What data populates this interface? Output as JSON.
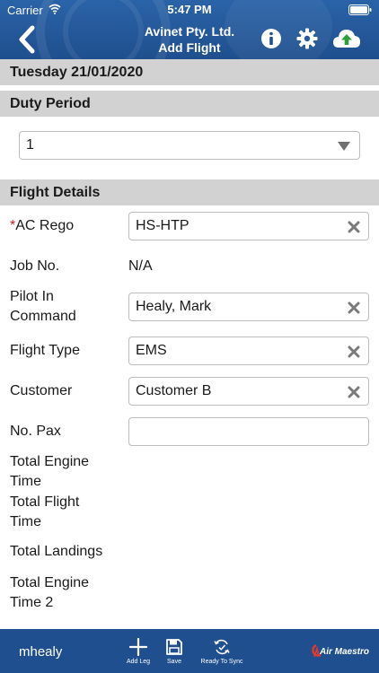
{
  "status_bar": {
    "carrier": "Carrier",
    "time": "5:47 PM"
  },
  "header": {
    "company": "Avinet Pty. Ltd.",
    "title": "Add Flight"
  },
  "date_bar": "Tuesday 21/01/2020",
  "duty_period": {
    "heading": "Duty Period",
    "selected": "1"
  },
  "flight_details": {
    "heading": "Flight Details",
    "ac_rego": {
      "required_mark": "*",
      "label": "AC Rego",
      "value": "HS-HTP"
    },
    "job_no": {
      "label": "Job No.",
      "value": "N/A"
    },
    "pilot_in_command": {
      "label_line1": "Pilot In",
      "label_line2": "Command",
      "value": "Healy, Mark"
    },
    "flight_type": {
      "label": "Flight Type",
      "value": "EMS"
    },
    "customer": {
      "label": "Customer",
      "value": "Customer B"
    },
    "no_pax": {
      "label": "No. Pax",
      "value": ""
    },
    "total_engine_time": {
      "label_line1": "Total Engine",
      "label_line2": "Time"
    },
    "total_flight_time": {
      "label_line1": "Total Flight",
      "label_line2": "Time"
    },
    "total_landings": {
      "label": "Total Landings"
    },
    "total_engine_time_2": {
      "label_line1": "Total Engine",
      "label_line2": "Time 2"
    }
  },
  "footer": {
    "user": "mhealy",
    "add_leg": "Add Leg",
    "save": "Save",
    "ready_to_sync": "Ready To Sync",
    "brand": "Air Maestro"
  },
  "colors": {
    "header": "#2a63a8",
    "footer": "#1f4f8e",
    "section_bar": "#d2d2d2",
    "upload_green": "#2e9e3a",
    "brand_red": "#e23a2e"
  }
}
